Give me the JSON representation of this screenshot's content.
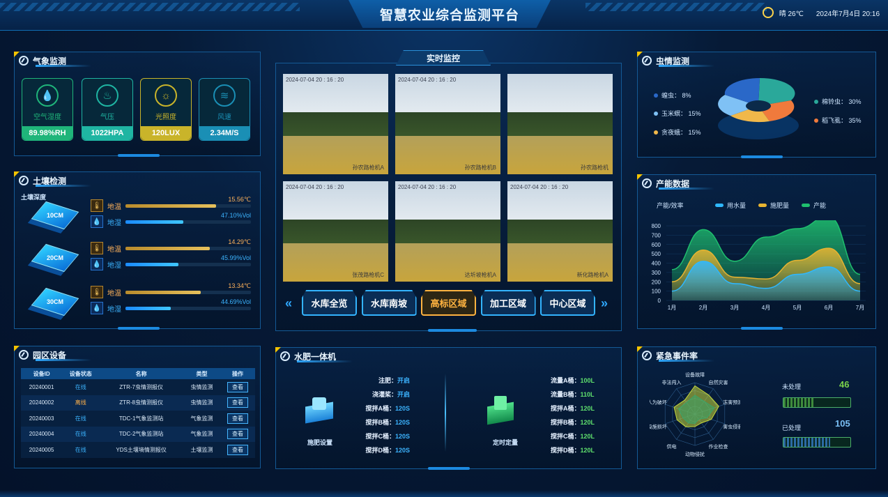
{
  "header": {
    "title": "智慧农业综合监测平台",
    "weather": "晴 26℃",
    "datetime": "2024年7月4日 20:16"
  },
  "weather_panel": {
    "title": "气象监测",
    "cards": [
      {
        "label": "空气湿度",
        "value": "89.98%RH",
        "color": "#1fb57a"
      },
      {
        "label": "气压",
        "value": "1022HPA",
        "color": "#1fb5a2"
      },
      {
        "label": "光照度",
        "value": "120LUX",
        "color": "#c9b42a"
      },
      {
        "label": "风速",
        "value": "2.34M/S",
        "color": "#1a8fb5"
      }
    ]
  },
  "soil_panel": {
    "title": "土壤检测",
    "depth_label": "土壤深度",
    "layers": [
      {
        "depth": "10CM",
        "temp_label": "地温",
        "temp": "15.56℃",
        "temp_pct": 0.72,
        "hum_label": "地湿",
        "hum": "47.10%Vol",
        "hum_pct": 0.46
      },
      {
        "depth": "20CM",
        "temp_label": "地温",
        "temp": "14.29℃",
        "temp_pct": 0.67,
        "hum_label": "地湿",
        "hum": "45.99%Vol",
        "hum_pct": 0.42
      },
      {
        "depth": "30CM",
        "temp_label": "地温",
        "temp": "13.34℃",
        "temp_pct": 0.6,
        "hum_label": "地湿",
        "hum": "44.69%Vol",
        "hum_pct": 0.36
      }
    ]
  },
  "device_panel": {
    "title": "园区设备",
    "headers": [
      "设备ID",
      "设备状态",
      "名称",
      "类型",
      "操作"
    ],
    "rows": [
      {
        "id": "20240001",
        "status": "在线",
        "name": "ZTR-7虫情测报仪",
        "type": "虫情监测",
        "op": "查看"
      },
      {
        "id": "20240002",
        "status": "离线",
        "name": "ZTR-8虫情测报仪",
        "type": "虫情监测",
        "op": "查看"
      },
      {
        "id": "20240003",
        "status": "在线",
        "name": "TDC-1气象监测站",
        "type": "气象监测",
        "op": "查看"
      },
      {
        "id": "20240004",
        "status": "在线",
        "name": "TDC-2气象监测站",
        "type": "气象监测",
        "op": "查看"
      },
      {
        "id": "20240005",
        "status": "在线",
        "name": "YDS土壤墒情测报仪",
        "type": "土壤监测",
        "op": "查看"
      }
    ]
  },
  "monitor_panel": {
    "title": "实时监控",
    "cameras": [
      {
        "ts": "2024-07-04  20 : 16 : 20",
        "name": "孙农路枪机A"
      },
      {
        "ts": "2024-07-04  20 : 16 : 20",
        "name": "孙农路枪机B"
      },
      {
        "ts": "",
        "name": "孙农路枪机"
      },
      {
        "ts": "2024-07-04  20 : 16 : 20",
        "name": "张茂路枪机C"
      },
      {
        "ts": "2024-07-04  20 : 16 : 20",
        "name": "达圻坡枪机A"
      },
      {
        "ts": "2024-07-04  20 : 16 : 20",
        "name": "新化路枪机A"
      }
    ],
    "tabs": [
      "水库全览",
      "水库南坡",
      "高标区域",
      "加工区域",
      "中心区域"
    ],
    "active_tab": 2
  },
  "fertilizer_panel": {
    "title": "水肥一体机",
    "left_label": "施肥设置",
    "right_label": "定时定量",
    "left_items": [
      {
        "k": "注肥：",
        "v": "开启"
      },
      {
        "k": "浇灌桨：",
        "v": "开启"
      },
      {
        "k": "搅拌A桶：",
        "v": "120S"
      },
      {
        "k": "搅拌B桶：",
        "v": "120S"
      },
      {
        "k": "搅拌C桶：",
        "v": "120S"
      },
      {
        "k": "搅拌D桶：",
        "v": "120S"
      }
    ],
    "right_items": [
      {
        "k": "流量A桶：",
        "v": "100L"
      },
      {
        "k": "流量B桶：",
        "v": "110L"
      },
      {
        "k": "搅拌A桶：",
        "v": "120L"
      },
      {
        "k": "搅拌B桶：",
        "v": "120L"
      },
      {
        "k": "搅拌C桶：",
        "v": "120L"
      },
      {
        "k": "搅拌D桶：",
        "v": "120L"
      }
    ]
  },
  "pest_panel": {
    "title": "虫情监测",
    "items": [
      {
        "label": "蝗虫：  8%",
        "color": "#2a68c8"
      },
      {
        "label": "玉米螟：  15%",
        "color": "#7fc1f5"
      },
      {
        "label": "贪夜蛾：  15%",
        "color": "#f1b84a"
      },
      {
        "label": "棉铃虫：  30%",
        "color": "#2aa89a"
      },
      {
        "label": "稻飞虱：  35%",
        "color": "#f07a3c"
      }
    ]
  },
  "production_panel": {
    "title": "产能数据",
    "ylabel": "产能/效率",
    "chart_data": {
      "type": "area",
      "categories": [
        "1月",
        "2月",
        "3月",
        "4月",
        "5月",
        "6月",
        "7月"
      ],
      "series": [
        {
          "name": "用水量",
          "values": [
            100,
            420,
            180,
            130,
            280,
            360,
            100
          ],
          "color": "#2fb8ff"
        },
        {
          "name": "施肥量",
          "values": [
            200,
            540,
            250,
            230,
            430,
            560,
            180
          ],
          "color": "#e7b431"
        },
        {
          "name": "产能",
          "values": [
            330,
            760,
            420,
            680,
            770,
            900,
            280
          ],
          "color": "#1fbf6e"
        }
      ],
      "ylim": [
        0,
        800
      ],
      "yticks": [
        "0",
        "100",
        "200",
        "300",
        "400",
        "500",
        "600",
        "700",
        "800"
      ]
    }
  },
  "emergency_panel": {
    "title": "紧急事件率",
    "radar_labels": [
      "设备故障",
      "自然灾害",
      "冻害预测",
      "害虫侵袭",
      "作业检查",
      "动物侵扰",
      "供电",
      "设施损坏",
      "人为破坏",
      "非法闯入"
    ],
    "unhandled_label": "未处理",
    "unhandled": "46",
    "unhandled_pct": 0.46,
    "handled_label": "已处理",
    "handled": "105",
    "handled_pct": 0.7
  }
}
